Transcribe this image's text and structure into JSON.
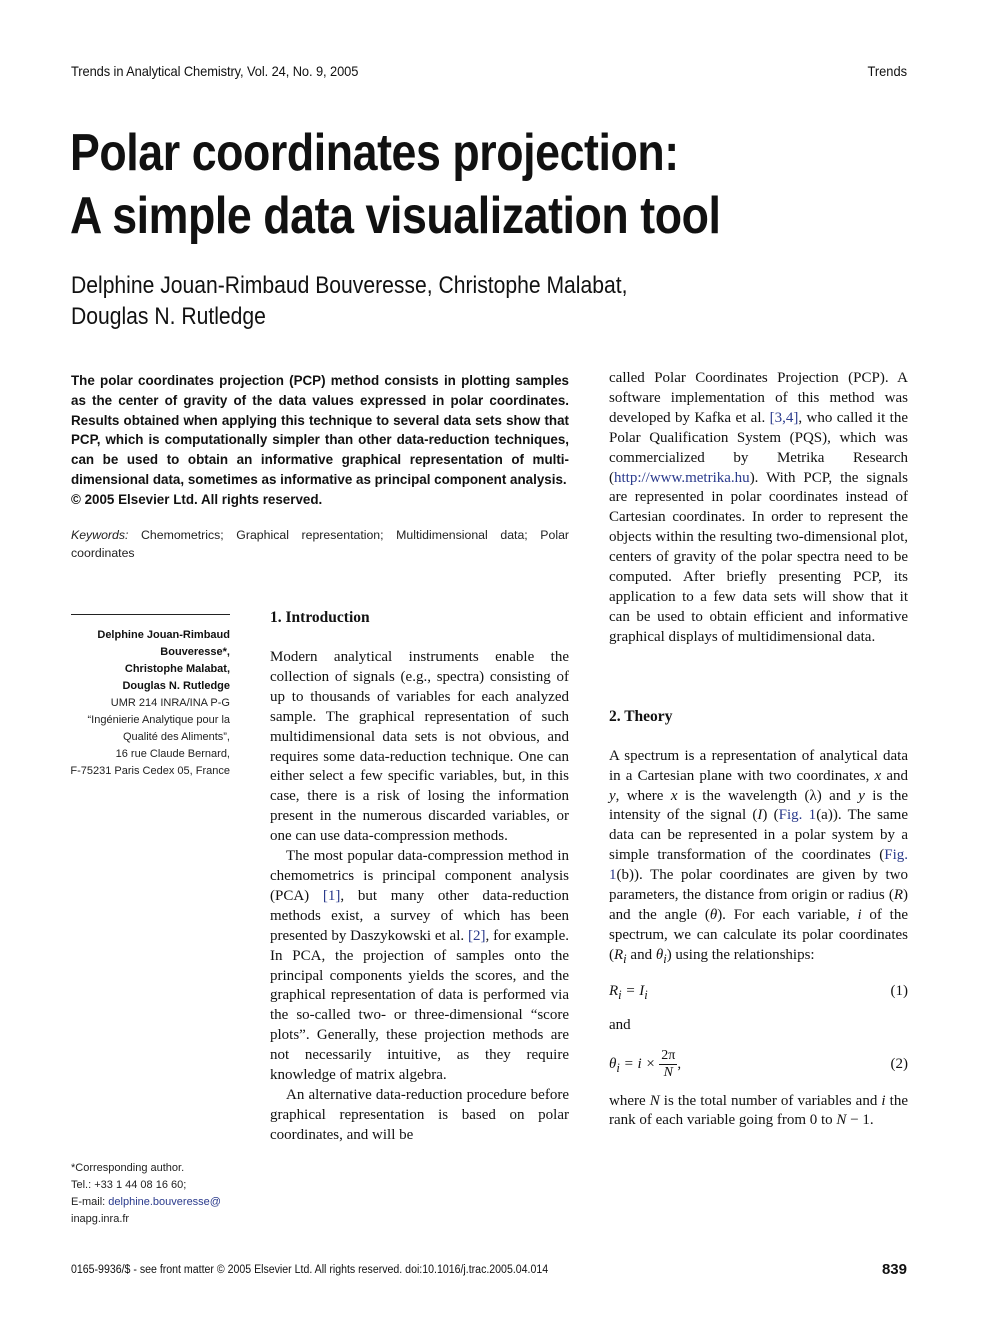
{
  "running_head": {
    "journal": "Trends in Analytical Chemistry, Vol. 24, No. 9, 2005",
    "section": "Trends"
  },
  "title": {
    "line1": "Polar coordinates projection:",
    "line2": "A simple data visualization tool"
  },
  "authors": {
    "line1": "Delphine Jouan-Rimbaud Bouveresse, Christophe Malabat,",
    "line2": "Douglas N. Rutledge"
  },
  "abstract": {
    "text": "The polar coordinates projection (PCP) method consists in plotting samples as the center of gravity of the data values expressed in polar coordinates. Results obtained when applying this technique to several data sets show that PCP, which is computationally simpler than other data-reduction techniques, can be used to obtain an informative graphical representation of multi-dimensional data, sometimes as informative as principal component analysis.",
    "copyright": "© 2005 Elsevier Ltd. All rights reserved."
  },
  "keywords": {
    "label": "Keywords:",
    "text": "Chemometrics; Graphical representation; Multidimensional data; Polar coordinates"
  },
  "affiliation": {
    "authors": [
      "Delphine Jouan-Rimbaud",
      "Bouveresse*,",
      "Christophe Malabat,",
      "Douglas N. Rutledge"
    ],
    "address": [
      "UMR 214 INRA/INA P-G",
      "“Ingénierie Analytique pour la",
      "Qualité des Aliments”,",
      "16 rue Claude Bernard,",
      "F-75231 Paris Cedex 05, France"
    ]
  },
  "footnote": {
    "corresponding": "*Corresponding author.",
    "tel": "Tel.: +33 1 44 08 16 60;",
    "email_label": "E-mail: ",
    "email_part1": "delphine.bouveresse@",
    "email_part2": "inapg.inra.fr"
  },
  "intro": {
    "heading": "1. Introduction",
    "p1": "Modern analytical instruments enable the collection of signals (e.g., spectra) consisting of up to thousands of variables for each analyzed sample. The graphical representation of such multidimensional data sets is not obvious, and requires some data-reduction technique. One can either select a few specific variables, but, in this case, there is a risk of losing the information present in the numerous discarded variables, or one can use data-compression methods.",
    "p2_a": "The most popular data-compression method in chemometrics is principal component analysis (PCA) ",
    "ref1": "[1]",
    "p2_b": ", but many other data-reduction methods exist, a survey of which has been presented by Daszykowski et al. ",
    "ref2": "[2]",
    "p2_c": ", for example. In PCA, the projection of samples onto the principal components yields the scores, and the graphical representation of data is performed via the so-called two- or three-dimensional “score plots”. Generally, these projection methods are not necessarily intuitive, as they require knowledge of matrix algebra.",
    "p3": "An alternative data-reduction procedure before graphical representation is based on polar coordinates, and will be"
  },
  "right_col": {
    "cont_a": "called Polar Coordinates Projection (PCP). A software implementation of this method was developed by Kafka et al. ",
    "ref34": "[3,4]",
    "cont_b": ", who called it the Polar Qualification System (PQS), which was commercialized by Metrika Research (",
    "url": "http://www.metrika.hu",
    "cont_c": "). With PCP, the signals are represented in polar coordinates instead of Cartesian coordinates. In order to represent the objects within the resulting two-dimensional plot, centers of gravity of the polar spectra need to be computed. After briefly presenting PCP, its application to a few data sets will show that it can be used to obtain efficient and informative graphical displays of multidimensional data."
  },
  "theory": {
    "heading": "2. Theory",
    "p1_a": "A spectrum is a representation of analytical data in a Cartesian plane with two coordinates, ",
    "x": "x",
    "and1": " and ",
    "y": "y",
    "p1_b": ", where ",
    "x2": "x",
    "p1_c": " is the wavelength (λ) and ",
    "y2": "y",
    "p1_d": " is the intensity of the signal (",
    "I": "I",
    "p1_e": ") (",
    "fig1a": "Fig. 1",
    "p1_f": "(a)). The same data can be represented in a polar system by a simple transformation of the coordinates (",
    "fig1b": "Fig. 1",
    "p1_g": "(b)). The polar coordinates are given by two parameters, the distance from origin or radius (",
    "R": "R",
    "p1_h": ") and the angle (",
    "theta": "θ",
    "p1_i": "). For each variable, ",
    "i": "i",
    "p1_j": " of the spectrum, we can calculate its polar coordinates (",
    "Ri": "R",
    "sub_i": "i",
    "p1_k": " and ",
    "thetai": "θ",
    "sub_i2": "i",
    "p1_l": ") using the relationships:",
    "eq1_lhs": "R",
    "eq1_sub": "i",
    "eq1_rhs": " = I",
    "eq1_sub2": "i",
    "eq1_num": "(1)",
    "and": "and",
    "eq2_lhs": "θ",
    "eq2_sub": "i",
    "eq2_mid": " = i × ",
    "eq2_frac_num": "2π",
    "eq2_frac_den": "N",
    "eq2_tail": ",",
    "eq2_num": "(2)",
    "p2_a": "where ",
    "N": "N",
    "p2_b": " is the total number of variables and ",
    "i2": "i",
    "p2_c": " the rank of each variable going from 0 to ",
    "N2": "N",
    "p2_d": " − 1."
  },
  "footer": {
    "issn_line": "0165-9936/$ - see front matter © 2005 Elsevier Ltd. All rights reserved.   doi:10.1016/j.trac.2005.04.014",
    "page_number": "839"
  }
}
